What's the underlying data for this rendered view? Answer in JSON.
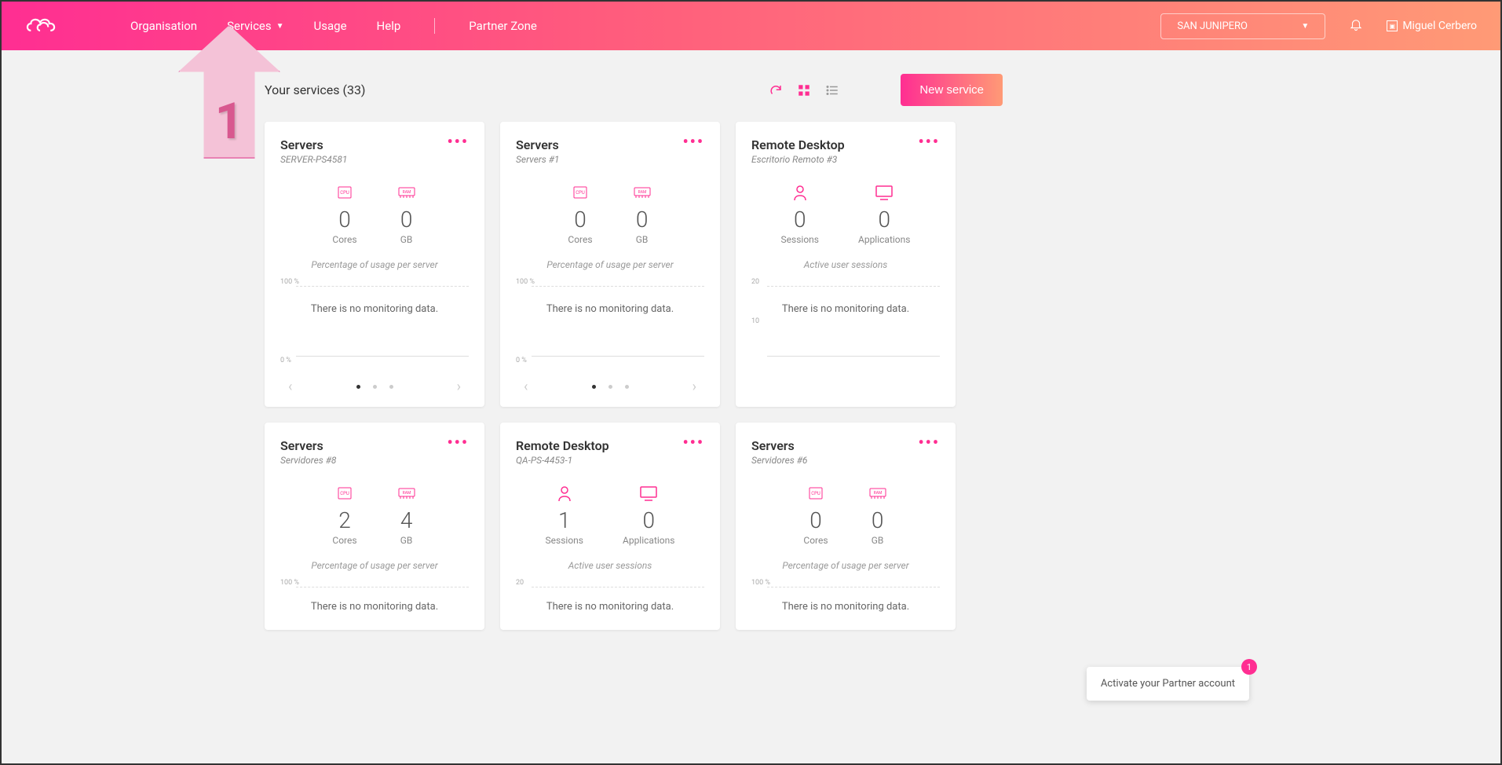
{
  "header": {
    "nav": {
      "organisation": "Organisation",
      "services": "Services",
      "usage": "Usage",
      "help": "Help",
      "partner_zone": "Partner Zone"
    },
    "org_selector": "SAN JUNIPERO",
    "user_name": "Miguel Cerbero"
  },
  "toolbar": {
    "title": "Your services (33)",
    "new_service": "New service"
  },
  "annotation": {
    "number": "1"
  },
  "toast": {
    "text": "Activate your Partner account",
    "badge": "1"
  },
  "common": {
    "no_data": "There is no monitoring data.",
    "usage_caption": "Percentage of usage per server",
    "sessions_caption": "Active user sessions",
    "cores": "Cores",
    "gb": "GB",
    "sessions": "Sessions",
    "applications": "Applications"
  },
  "cards": [
    {
      "title": "Servers",
      "sub": "SERVER-PS4581",
      "type": "server",
      "v1": "0",
      "v2": "0",
      "ytop": "100 %",
      "ybot": "0 %",
      "pager": true
    },
    {
      "title": "Servers",
      "sub": "Servers #1",
      "type": "server",
      "v1": "0",
      "v2": "0",
      "ytop": "100 %",
      "ybot": "0 %",
      "pager": true
    },
    {
      "title": "Remote Desktop",
      "sub": "Escritorio Remoto #3",
      "type": "remote",
      "v1": "0",
      "v2": "0",
      "ytop": "20",
      "ymid": "10",
      "pager": false
    },
    {
      "title": "Servers",
      "sub": "Servidores #8",
      "type": "server",
      "v1": "2",
      "v2": "4",
      "ytop": "100 %",
      "short": true
    },
    {
      "title": "Remote Desktop",
      "sub": "QA-PS-4453-1",
      "type": "remote",
      "v1": "1",
      "v2": "0",
      "ytop": "20",
      "short": true
    },
    {
      "title": "Servers",
      "sub": "Servidores #6",
      "type": "server",
      "v1": "0",
      "v2": "0",
      "ytop": "100 %",
      "short": true
    }
  ]
}
